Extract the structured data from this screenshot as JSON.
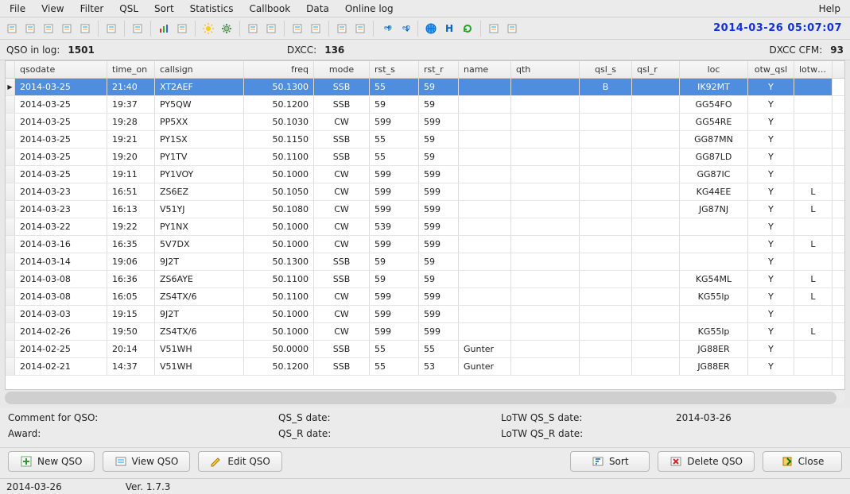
{
  "menu": {
    "items": [
      "File",
      "View",
      "Filter",
      "QSL",
      "Sort",
      "Statistics",
      "Callbook",
      "Data",
      "Online log"
    ],
    "help": "Help"
  },
  "clock": "2014-03-26  05:07:07",
  "stats": {
    "qso_in_log_label": "QSO in log:",
    "qso_in_log_value": "1501",
    "dxcc_label": "DXCC:",
    "dxcc_value": "136",
    "dxcc_cfm_label": "DXCC CFM:",
    "dxcc_cfm_value": "93"
  },
  "columns": {
    "qsodate": "qsodate",
    "timeon": "time_on",
    "callsign": "callsign",
    "freq": "freq",
    "mode": "mode",
    "rsts": "rst_s",
    "rstr": "rst_r",
    "name": "name",
    "qth": "qth",
    "qsls": "qsl_s",
    "qslr": "qsl_r",
    "loc": "loc",
    "otw": "otw_qsl",
    "lotw": "lotw_q"
  },
  "rows": [
    {
      "qsodate": "2014-03-25",
      "timeon": "21:40",
      "callsign": "XT2AEF",
      "freq": "50.1300",
      "mode": "SSB",
      "rsts": "55",
      "rstr": "59",
      "name": "",
      "qth": "",
      "qsls": "B",
      "qslr": "",
      "loc": "IK92MT",
      "otw": "Y",
      "lotw": ""
    },
    {
      "qsodate": "2014-03-25",
      "timeon": "19:37",
      "callsign": "PY5QW",
      "freq": "50.1200",
      "mode": "SSB",
      "rsts": "59",
      "rstr": "59",
      "name": "",
      "qth": "",
      "qsls": "",
      "qslr": "",
      "loc": "GG54FO",
      "otw": "Y",
      "lotw": ""
    },
    {
      "qsodate": "2014-03-25",
      "timeon": "19:28",
      "callsign": "PP5XX",
      "freq": "50.1030",
      "mode": "CW",
      "rsts": "599",
      "rstr": "599",
      "name": "",
      "qth": "",
      "qsls": "",
      "qslr": "",
      "loc": "GG54RE",
      "otw": "Y",
      "lotw": ""
    },
    {
      "qsodate": "2014-03-25",
      "timeon": "19:21",
      "callsign": "PY1SX",
      "freq": "50.1150",
      "mode": "SSB",
      "rsts": "55",
      "rstr": "59",
      "name": "",
      "qth": "",
      "qsls": "",
      "qslr": "",
      "loc": "GG87MN",
      "otw": "Y",
      "lotw": ""
    },
    {
      "qsodate": "2014-03-25",
      "timeon": "19:20",
      "callsign": "PY1TV",
      "freq": "50.1100",
      "mode": "SSB",
      "rsts": "55",
      "rstr": "59",
      "name": "",
      "qth": "",
      "qsls": "",
      "qslr": "",
      "loc": "GG87LD",
      "otw": "Y",
      "lotw": ""
    },
    {
      "qsodate": "2014-03-25",
      "timeon": "19:11",
      "callsign": "PY1VOY",
      "freq": "50.1000",
      "mode": "CW",
      "rsts": "599",
      "rstr": "599",
      "name": "",
      "qth": "",
      "qsls": "",
      "qslr": "",
      "loc": "GG87IC",
      "otw": "Y",
      "lotw": ""
    },
    {
      "qsodate": "2014-03-23",
      "timeon": "16:51",
      "callsign": "ZS6EZ",
      "freq": "50.1050",
      "mode": "CW",
      "rsts": "599",
      "rstr": "599",
      "name": "",
      "qth": "",
      "qsls": "",
      "qslr": "",
      "loc": "KG44EE",
      "otw": "Y",
      "lotw": "L"
    },
    {
      "qsodate": "2014-03-23",
      "timeon": "16:13",
      "callsign": "V51YJ",
      "freq": "50.1080",
      "mode": "CW",
      "rsts": "599",
      "rstr": "599",
      "name": "",
      "qth": "",
      "qsls": "",
      "qslr": "",
      "loc": "JG87NJ",
      "otw": "Y",
      "lotw": "L"
    },
    {
      "qsodate": "2014-03-22",
      "timeon": "19:22",
      "callsign": "PY1NX",
      "freq": "50.1000",
      "mode": "CW",
      "rsts": "539",
      "rstr": "599",
      "name": "",
      "qth": "",
      "qsls": "",
      "qslr": "",
      "loc": "",
      "otw": "Y",
      "lotw": ""
    },
    {
      "qsodate": "2014-03-16",
      "timeon": "16:35",
      "callsign": "5V7DX",
      "freq": "50.1000",
      "mode": "CW",
      "rsts": "599",
      "rstr": "599",
      "name": "",
      "qth": "",
      "qsls": "",
      "qslr": "",
      "loc": "",
      "otw": "Y",
      "lotw": "L"
    },
    {
      "qsodate": "2014-03-14",
      "timeon": "19:06",
      "callsign": "9J2T",
      "freq": "50.1300",
      "mode": "SSB",
      "rsts": "59",
      "rstr": "59",
      "name": "",
      "qth": "",
      "qsls": "",
      "qslr": "",
      "loc": "",
      "otw": "Y",
      "lotw": ""
    },
    {
      "qsodate": "2014-03-08",
      "timeon": "16:36",
      "callsign": "ZS6AYE",
      "freq": "50.1100",
      "mode": "SSB",
      "rsts": "59",
      "rstr": "59",
      "name": "",
      "qth": "",
      "qsls": "",
      "qslr": "",
      "loc": "KG54ML",
      "otw": "Y",
      "lotw": "L"
    },
    {
      "qsodate": "2014-03-08",
      "timeon": "16:05",
      "callsign": "ZS4TX/6",
      "freq": "50.1100",
      "mode": "CW",
      "rsts": "599",
      "rstr": "599",
      "name": "",
      "qth": "",
      "qsls": "",
      "qslr": "",
      "loc": "KG55lp",
      "otw": "Y",
      "lotw": "L"
    },
    {
      "qsodate": "2014-03-03",
      "timeon": "19:15",
      "callsign": "9J2T",
      "freq": "50.1000",
      "mode": "CW",
      "rsts": "599",
      "rstr": "599",
      "name": "",
      "qth": "",
      "qsls": "",
      "qslr": "",
      "loc": "",
      "otw": "Y",
      "lotw": ""
    },
    {
      "qsodate": "2014-02-26",
      "timeon": "19:50",
      "callsign": "ZS4TX/6",
      "freq": "50.1000",
      "mode": "CW",
      "rsts": "599",
      "rstr": "599",
      "name": "",
      "qth": "",
      "qsls": "",
      "qslr": "",
      "loc": "KG55lp",
      "otw": "Y",
      "lotw": "L"
    },
    {
      "qsodate": "2014-02-25",
      "timeon": "20:14",
      "callsign": "V51WH",
      "freq": "50.0000",
      "mode": "SSB",
      "rsts": "55",
      "rstr": "55",
      "name": "Gunter",
      "qth": "",
      "qsls": "",
      "qslr": "",
      "loc": "JG88ER",
      "otw": "Y",
      "lotw": ""
    },
    {
      "qsodate": "2014-02-21",
      "timeon": "14:37",
      "callsign": "V51WH",
      "freq": "50.1200",
      "mode": "SSB",
      "rsts": "55",
      "rstr": "53",
      "name": "Gunter",
      "qth": "",
      "qsls": "",
      "qslr": "",
      "loc": "JG88ER",
      "otw": "Y",
      "lotw": ""
    }
  ],
  "info": {
    "comment_label": "Comment for QSO:",
    "award_label": "Award:",
    "qss_label": "QS_S date:",
    "qsr_label": "QS_R date:",
    "lotw_qss_label": "LoTW QS_S date:",
    "lotw_qsr_label": "LoTW QS_R date:",
    "lotw_qss_value": "2014-03-26"
  },
  "buttons": {
    "new": "New QSO",
    "view": "View QSO",
    "edit": "Edit QSO",
    "sort": "Sort",
    "delete": "Delete QSO",
    "close": "Close"
  },
  "status": {
    "date": "2014-03-26",
    "version": "Ver. 1.7.3"
  },
  "toolbar_icons": [
    "new-qso-icon",
    "view-qso-icon",
    "edit-qso-icon",
    "copy-qso-icon",
    "grid-icon",
    "SEP",
    "tool-wrench-icon",
    "SEP",
    "window-icon",
    "SEP",
    "chart-bar-icon",
    "table-icon",
    "SEP",
    "sun-icon",
    "gear-icon",
    "SEP",
    "doc-new-icon",
    "doc-icon",
    "SEP",
    "list-green-icon",
    "list-blue-icon",
    "SEP",
    "export-icon",
    "import-icon",
    "SEP",
    "eq-up-icon",
    "eq-down-icon",
    "SEP",
    "globe-icon",
    "home-icon",
    "refresh-icon",
    "SEP",
    "device-icon",
    "props-icon"
  ]
}
